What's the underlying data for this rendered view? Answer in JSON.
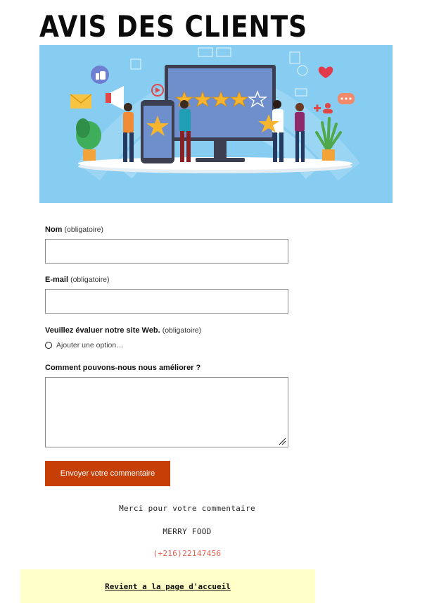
{
  "page": {
    "title": "AVIS DES CLIENTS"
  },
  "form": {
    "name_label": "Nom",
    "email_label": "E-mail",
    "rating_label": "Veuillez évaluer notre site Web.",
    "required_text": "(obligatoire)",
    "rating_option": "Ajouter une option…",
    "comment_label": "Comment pouvons-nous nous améliorer ?",
    "name_value": "",
    "email_value": "",
    "comment_value": "",
    "submit_label": "Envoyer votre commentaire"
  },
  "footer": {
    "thanks": "Merci pour votre commentaire",
    "brand": "MERRY FOOD",
    "phone": "(+216)22147456",
    "home_link": "Revient a la page d'accueil"
  },
  "colors": {
    "accent": "#c63f06",
    "hero_bg": "#87cdf1",
    "footer_bg": "#ffffc7",
    "phone": "#e0604e"
  },
  "icons": [
    "thumbs-up-icon",
    "megaphone-icon",
    "mail-icon",
    "heart-icon",
    "chat-icon",
    "star-icon",
    "monitor-icon",
    "smartphone-icon",
    "plant-icon",
    "play-icon",
    "add-user-icon"
  ]
}
